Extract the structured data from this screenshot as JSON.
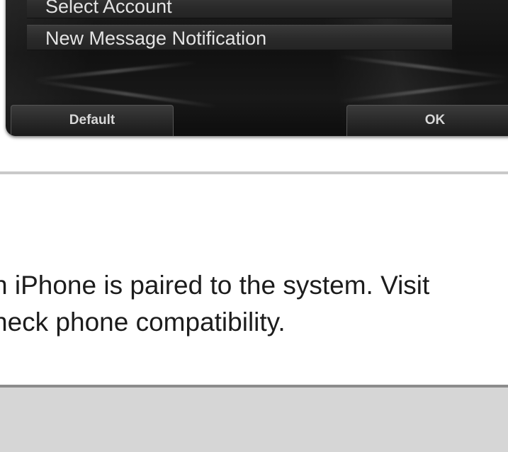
{
  "dialog": {
    "menu_items": [
      {
        "label": "Select Account"
      },
      {
        "label": "New Message Notification"
      }
    ],
    "buttons": {
      "default_label": "Default",
      "ok_label": "OK"
    }
  },
  "note": {
    "line1": "n iPhone is paired to the system. Visit",
    "line2": "heck phone compatibility."
  }
}
